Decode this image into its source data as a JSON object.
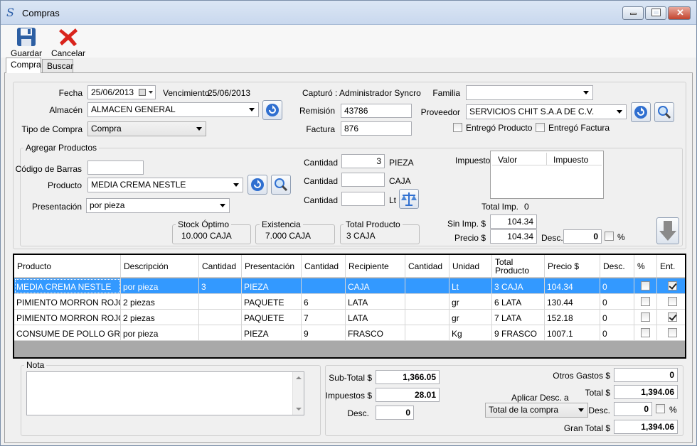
{
  "window": {
    "title": "Compras"
  },
  "toolbar": {
    "save_label": "Guardar",
    "cancel_label": "Cancelar"
  },
  "tabs": [
    {
      "label": "Compra"
    },
    {
      "label": "Buscar"
    }
  ],
  "header": {
    "fecha_label": "Fecha",
    "fecha_value": "25/06/2013",
    "vencimiento_label": "Vencimiento",
    "vencimiento_value": "25/06/2013",
    "capturo_text": "Capturó : Administrador Syncro",
    "familia_label": "Familia",
    "familia_value": "",
    "almacen_label": "Almacén",
    "almacen_value": "ALMACEN GENERAL",
    "remision_label": "Remisión",
    "remision_value": "43786",
    "proveedor_label": "Proveedor",
    "proveedor_value": "SERVICIOS CHIT S.A.A DE C.V.",
    "tipo_label": "Tipo de Compra",
    "tipo_value": "Compra",
    "factura_label": "Factura",
    "factura_value": "876",
    "entrego_producto_label": "Entregó Producto",
    "entrego_factura_label": "Entregó Factura"
  },
  "agregar": {
    "title": "Agregar Productos",
    "codigo_label": "Código de Barras",
    "codigo_value": "",
    "producto_label": "Producto",
    "producto_value": "MEDIA CREMA NESTLE",
    "presentacion_label": "Presentación",
    "presentacion_value": "por pieza",
    "cantidad_label": "Cantidad",
    "cantidad1_value": "3",
    "unit1": "PIEZA",
    "cantidad2_value": "",
    "unit2": "CAJA",
    "cantidad3_value": "",
    "unit3": "Lt",
    "stock_title": "Stock Óptimo",
    "stock_value": "10.000 CAJA",
    "existencia_title": "Existencia",
    "existencia_value": "7.000 CAJA",
    "total_producto_title": "Total Producto",
    "total_producto_value": "3 CAJA",
    "impuesto_label": "Impuesto:",
    "imp_col_valor": "Valor",
    "imp_col_impuesto": "Impuesto",
    "total_imp_label": "Total Imp.",
    "total_imp_value": "0",
    "sin_imp_label": "Sin Imp. $",
    "sin_imp_value": "104.34",
    "precio_label": "Precio $",
    "precio_value": "104.34",
    "desc_label": "Desc.",
    "desc_value": "0",
    "pct_label": "%"
  },
  "grid": {
    "columns": [
      "Producto",
      "Descripción",
      "Cantidad",
      "Presentación",
      "Cantidad",
      "Recipiente",
      "Cantidad",
      "Unidad",
      "Total Producto",
      "Precio $",
      "Desc.",
      "%",
      "Ent."
    ],
    "rows": [
      {
        "producto": "MEDIA CREMA NESTLE",
        "descripcion": "por pieza",
        "cant1": "3",
        "presentacion": "PIEZA",
        "cant2": "",
        "recipiente": "CAJA",
        "cant3": "",
        "unidad": "Lt",
        "total": "3 CAJA",
        "precio": "104.34",
        "desc": "0",
        "pct": false,
        "ent": true
      },
      {
        "producto": "PIMIENTO MORRON ROJO",
        "descripcion": "2 piezas",
        "cant1": "",
        "presentacion": "PAQUETE",
        "cant2": "6",
        "recipiente": "LATA",
        "cant3": "",
        "unidad": "gr",
        "total": "6 LATA",
        "precio": "130.44",
        "desc": "0",
        "pct": false,
        "ent": false
      },
      {
        "producto": "PIMIENTO MORRON ROJO",
        "descripcion": "2 piezas",
        "cant1": "",
        "presentacion": "PAQUETE",
        "cant2": "7",
        "recipiente": "LATA",
        "cant3": "",
        "unidad": "gr",
        "total": "7 LATA",
        "precio": "152.18",
        "desc": "0",
        "pct": false,
        "ent": true
      },
      {
        "producto": "CONSUME DE POLLO GR...",
        "descripcion": "por pieza",
        "cant1": "",
        "presentacion": "PIEZA",
        "cant2": "9",
        "recipiente": "FRASCO",
        "cant3": "",
        "unidad": "Kg",
        "total": "9 FRASCO",
        "precio": "1007.1",
        "desc": "0",
        "pct": false,
        "ent": false
      }
    ]
  },
  "nota": {
    "title": "Nota",
    "value": ""
  },
  "totales": {
    "subtotal_label": "Sub-Total $",
    "subtotal_value": "1,366.05",
    "impuestos_label": "Impuestos $",
    "impuestos_value": "28.01",
    "desc_label": "Desc.",
    "desc_value": "0",
    "otros_gastos_label": "Otros Gastos $",
    "otros_gastos_value": "0",
    "aplicar_label": "Aplicar Desc. a",
    "aplicar_value": "Total de la compra",
    "total_label": "Total $",
    "total_value": "1,394.06",
    "desc2_label": "Desc.",
    "desc2_value": "0",
    "pct_label": "%",
    "gran_total_label": "Gran Total $",
    "gran_total_value": "1,394.06"
  },
  "colors": {
    "selection": "#3399ff",
    "cancel_red": "#d9241c",
    "refresh_blue": "#2f6fd0"
  }
}
